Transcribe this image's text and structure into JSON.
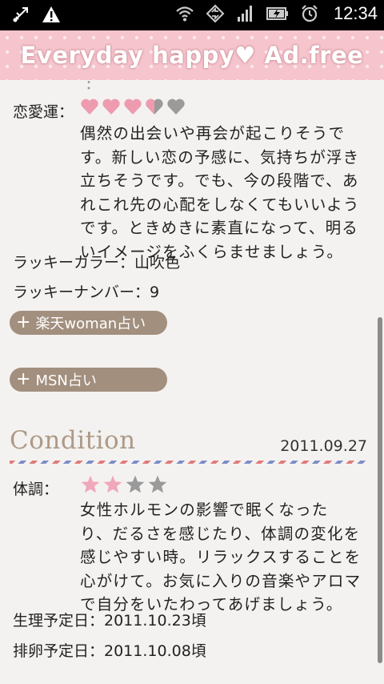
{
  "status_bar": {
    "time": "12:34",
    "left_icons": [
      "usb-debug-icon",
      "warning-icon"
    ],
    "right_icons": [
      "wifi-icon",
      "sync-icon",
      "signal-icon",
      "battery-charging-icon",
      "alarm-icon"
    ]
  },
  "banner": {
    "text": "Everyday happy♥ Ad.free"
  },
  "love": {
    "label": "恋愛運：",
    "hearts_rating": 3.5,
    "hearts_total": 5,
    "lines": [
      "偶然の出会いや再会が起こりそうで",
      "す。新しい恋の予感に、気持ちが浮き",
      "立ちそうです。でも、今の段階で、あ",
      "れこれ先の心配をしなくてもいいよう",
      "です。ときめきに素直になって、明る",
      "いイメージをふくらませましょう。"
    ]
  },
  "lucky_color": "ラッキーカラー：山吹色",
  "lucky_number": "ラッキーナンバー：9",
  "links": {
    "rakuten": "楽天woman占い",
    "msn": "MSN占い"
  },
  "condition": {
    "title": "Condition",
    "date": "2011.09.27",
    "label": "体調：",
    "stars_rating": 2,
    "stars_total": 4,
    "lines": [
      "女性ホルモンの影響で眠くなった",
      "り、だるさを感じたり、体調の変化を",
      "感じやすい時。リラックスすることを",
      "心がけて。お気に入りの音楽やアロマ",
      "で自分をいたわってあげましょう。"
    ],
    "period_date": "生理予定日：2011.10.23頃",
    "ovulation_date": "排卵予定日：2011.10.08頃"
  },
  "colors": {
    "heart_pink": "#ee9bb0",
    "heart_gray": "#9a9a9a",
    "star_pink": "#f0a8bb",
    "star_gray": "#9a9a9a",
    "pill_brown": "#a28f7e",
    "banner_pink": "#f5c4cc"
  }
}
